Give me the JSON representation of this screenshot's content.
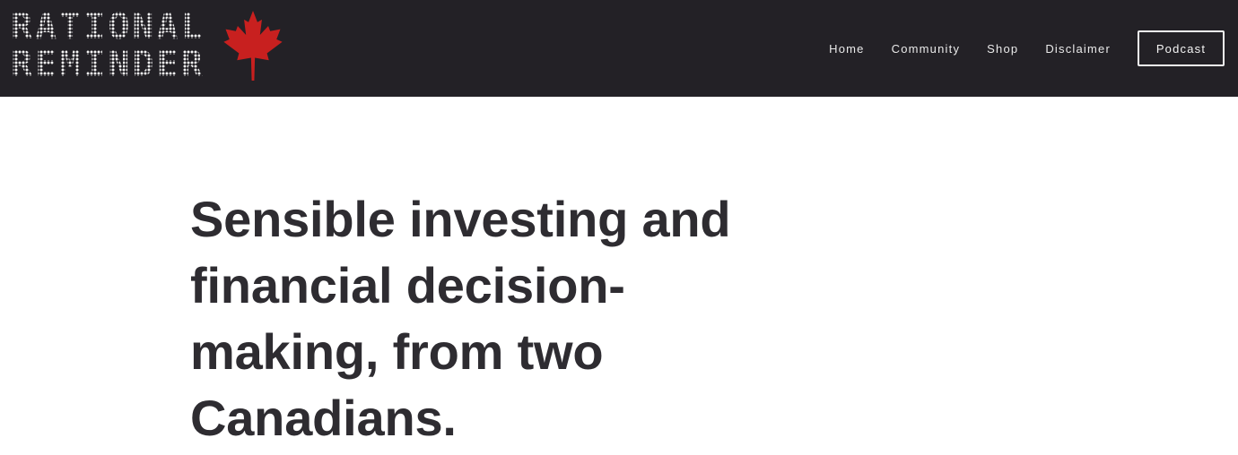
{
  "header": {
    "logo_line1": "RATIONAL",
    "logo_line2": "REMINDER",
    "logo_icon": "maple-leaf-icon",
    "background_color": "#232126",
    "leaf_color": "#c8201f"
  },
  "nav": {
    "items": [
      {
        "label": "Home"
      },
      {
        "label": "Community"
      },
      {
        "label": "Shop"
      },
      {
        "label": "Disclaimer"
      }
    ],
    "cta_label": "Podcast"
  },
  "hero": {
    "title": "Sensible investing and financial decision-making, from two Canadians.",
    "text_color": "#2e2c31"
  }
}
